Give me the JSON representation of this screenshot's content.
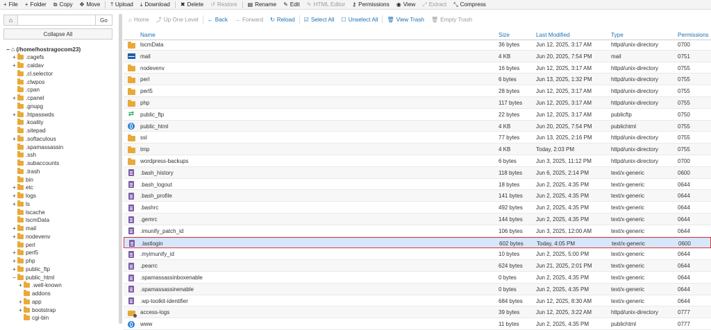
{
  "toolbar": [
    {
      "name": "file-button",
      "icon": "plus-icon",
      "glyph": "+",
      "label": "File",
      "disabled": false
    },
    {
      "name": "folder-button",
      "icon": "plus-icon",
      "glyph": "+",
      "label": "Folder",
      "disabled": false
    },
    {
      "name": "copy-button",
      "icon": "copy-icon",
      "glyph": "⧉",
      "label": "Copy",
      "disabled": false
    },
    {
      "name": "move-button",
      "icon": "move-icon",
      "glyph": "✥",
      "label": "Move",
      "disabled": false
    },
    {
      "name": "upload-button",
      "icon": "upload-icon",
      "glyph": "⤒",
      "label": "Upload",
      "disabled": false
    },
    {
      "name": "download-button",
      "icon": "download-icon",
      "glyph": "⤓",
      "label": "Download",
      "disabled": false
    },
    {
      "name": "delete-button",
      "icon": "close-icon",
      "glyph": "✖",
      "label": "Delete",
      "disabled": false
    },
    {
      "name": "restore-button",
      "icon": "restore-icon",
      "glyph": "↺",
      "label": "Restore",
      "disabled": true
    },
    {
      "name": "rename-button",
      "icon": "file-icon",
      "glyph": "▤",
      "label": "Rename",
      "disabled": false
    },
    {
      "name": "edit-button",
      "icon": "pencil-icon",
      "glyph": "✎",
      "label": "Edit",
      "disabled": false
    },
    {
      "name": "html-editor-button",
      "icon": "pencil-icon",
      "glyph": "✎",
      "label": "HTML Editor",
      "disabled": true
    },
    {
      "name": "permissions-button",
      "icon": "key-icon",
      "glyph": "⚷",
      "label": "Permissions",
      "disabled": false
    },
    {
      "name": "view-button",
      "icon": "eye-icon",
      "glyph": "◉",
      "label": "View",
      "disabled": false
    },
    {
      "name": "extract-button",
      "icon": "extract-icon",
      "glyph": "⤢",
      "label": "Extract",
      "disabled": true
    },
    {
      "name": "compress-button",
      "icon": "compress-icon",
      "glyph": "⤡",
      "label": "Compress",
      "disabled": false
    }
  ],
  "left": {
    "go_label": "Go",
    "collapse_label": "Collapse All",
    "path_value": ""
  },
  "tree": [
    {
      "label": "(/home/hostragocom23)",
      "level": 0,
      "toggle": "−",
      "root": true
    },
    {
      "label": ".cagefs",
      "level": 1,
      "toggle": "+"
    },
    {
      "label": ".caldav",
      "level": 1,
      "toggle": "+"
    },
    {
      "label": ".cl.selector",
      "level": 1,
      "toggle": ""
    },
    {
      "label": ".clwpos",
      "level": 1,
      "toggle": ""
    },
    {
      "label": ".cpan",
      "level": 1,
      "toggle": ""
    },
    {
      "label": ".cpanel",
      "level": 1,
      "toggle": "+"
    },
    {
      "label": ".gnupg",
      "level": 1,
      "toggle": ""
    },
    {
      "label": ".htpasswds",
      "level": 1,
      "toggle": "+"
    },
    {
      "label": ".koality",
      "level": 1,
      "toggle": ""
    },
    {
      "label": ".sitepad",
      "level": 1,
      "toggle": ""
    },
    {
      "label": ".softaculous",
      "level": 1,
      "toggle": "+"
    },
    {
      "label": ".spamassassin",
      "level": 1,
      "toggle": ""
    },
    {
      "label": ".ssh",
      "level": 1,
      "toggle": ""
    },
    {
      "label": ".subaccounts",
      "level": 1,
      "toggle": ""
    },
    {
      "label": ".trash",
      "level": 1,
      "toggle": ""
    },
    {
      "label": "bin",
      "level": 1,
      "toggle": ""
    },
    {
      "label": "etc",
      "level": 1,
      "toggle": "+"
    },
    {
      "label": "logs",
      "level": 1,
      "toggle": "+"
    },
    {
      "label": "ls",
      "level": 1,
      "toggle": "+"
    },
    {
      "label": "lscache",
      "level": 1,
      "toggle": ""
    },
    {
      "label": "lscmData",
      "level": 1,
      "toggle": ""
    },
    {
      "label": "mail",
      "level": 1,
      "toggle": "+"
    },
    {
      "label": "nodevenv",
      "level": 1,
      "toggle": "+"
    },
    {
      "label": "perl",
      "level": 1,
      "toggle": ""
    },
    {
      "label": "perl5",
      "level": 1,
      "toggle": "+"
    },
    {
      "label": "php",
      "level": 1,
      "toggle": "+"
    },
    {
      "label": "public_ftp",
      "level": 1,
      "toggle": "+"
    },
    {
      "label": "public_html",
      "level": 1,
      "toggle": "−"
    },
    {
      "label": ".well-known",
      "level": 2,
      "toggle": "+"
    },
    {
      "label": "addons",
      "level": 2,
      "toggle": ""
    },
    {
      "label": "app",
      "level": 2,
      "toggle": "+"
    },
    {
      "label": "bootstrap",
      "level": 2,
      "toggle": "+"
    },
    {
      "label": "cgi-bin",
      "level": 2,
      "toggle": ""
    }
  ],
  "navbar": [
    {
      "name": "home-nav-button",
      "icon": "home-icon",
      "glyph": "⌂",
      "label": "Home",
      "disabled": true
    },
    {
      "name": "up-one-level-button",
      "icon": "up-arrow-icon",
      "glyph": "⤴",
      "label": "Up One Level",
      "disabled": true
    },
    {
      "name": "back-button",
      "icon": "left-arrow-icon",
      "glyph": "←",
      "label": "Back",
      "disabled": false
    },
    {
      "name": "forward-button",
      "icon": "right-arrow-icon",
      "glyph": "→",
      "label": "Forward",
      "disabled": true
    },
    {
      "name": "reload-button",
      "icon": "reload-icon",
      "glyph": "↻",
      "label": "Reload",
      "disabled": false
    },
    {
      "name": "select-all-button",
      "icon": "checkbox-checked-icon",
      "glyph": "☑",
      "label": "Select All",
      "disabled": false
    },
    {
      "name": "unselect-all-button",
      "icon": "checkbox-empty-icon",
      "glyph": "☐",
      "label": "Unselect All",
      "disabled": false
    },
    {
      "name": "view-trash-button",
      "icon": "trash-icon",
      "glyph": "🗑",
      "label": "View Trash",
      "disabled": false
    },
    {
      "name": "empty-trash-button",
      "icon": "trash-icon",
      "glyph": "🗑",
      "label": "Empty Trash",
      "disabled": true
    }
  ],
  "table": {
    "headers": {
      "name": "Name",
      "size": "Size",
      "modified": "Last Modified",
      "type": "Type",
      "perms": "Permissions"
    },
    "rows": [
      {
        "icon": "folder",
        "name": "lscmData",
        "size": "36 bytes",
        "modified": "Jun 12, 2025, 3:17 AM",
        "type": "httpd/unix-directory",
        "perms": "0700"
      },
      {
        "icon": "mail",
        "name": "mail",
        "size": "4 KB",
        "modified": "Jun 20, 2025, 7:54 PM",
        "type": "mail",
        "perms": "0751"
      },
      {
        "icon": "folder",
        "name": "nodevenv",
        "size": "16 bytes",
        "modified": "Jun 12, 2025, 3:17 AM",
        "type": "httpd/unix-directory",
        "perms": "0755"
      },
      {
        "icon": "folder",
        "name": "perl",
        "size": "6 bytes",
        "modified": "Jun 13, 2025, 1:32 PM",
        "type": "httpd/unix-directory",
        "perms": "0755"
      },
      {
        "icon": "folder",
        "name": "perl5",
        "size": "28 bytes",
        "modified": "Jun 12, 2025, 3:17 AM",
        "type": "httpd/unix-directory",
        "perms": "0755"
      },
      {
        "icon": "folder",
        "name": "php",
        "size": "117 bytes",
        "modified": "Jun 12, 2025, 3:17 AM",
        "type": "httpd/unix-directory",
        "perms": "0755"
      },
      {
        "icon": "arrows",
        "name": "public_ftp",
        "size": "22 bytes",
        "modified": "Jun 12, 2025, 3:17 AM",
        "type": "publicftp",
        "perms": "0750"
      },
      {
        "icon": "globe",
        "name": "public_html",
        "size": "4 KB",
        "modified": "Jun 20, 2025, 7:54 PM",
        "type": "publichtml",
        "perms": "0755"
      },
      {
        "icon": "folder",
        "name": "ssl",
        "size": "77 bytes",
        "modified": "Jun 13, 2025, 2:16 PM",
        "type": "httpd/unix-directory",
        "perms": "0755"
      },
      {
        "icon": "folder",
        "name": "tmp",
        "size": "4 KB",
        "modified": "Today, 2:03 PM",
        "type": "httpd/unix-directory",
        "perms": "0755"
      },
      {
        "icon": "folder",
        "name": "wordpress-backups",
        "size": "6 bytes",
        "modified": "Jun 3, 2025, 11:12 PM",
        "type": "httpd/unix-directory",
        "perms": "0700"
      },
      {
        "icon": "file",
        "name": ".bash_history",
        "size": "118 bytes",
        "modified": "Jun 6, 2025, 2:14 PM",
        "type": "text/x-generic",
        "perms": "0600"
      },
      {
        "icon": "file",
        "name": ".bash_logout",
        "size": "18 bytes",
        "modified": "Jun 2, 2025, 4:35 PM",
        "type": "text/x-generic",
        "perms": "0644"
      },
      {
        "icon": "file",
        "name": ".bash_profile",
        "size": "141 bytes",
        "modified": "Jun 2, 2025, 4:35 PM",
        "type": "text/x-generic",
        "perms": "0644"
      },
      {
        "icon": "file",
        "name": ".bashrc",
        "size": "492 bytes",
        "modified": "Jun 2, 2025, 4:35 PM",
        "type": "text/x-generic",
        "perms": "0644"
      },
      {
        "icon": "file",
        "name": ".gemrc",
        "size": "144 bytes",
        "modified": "Jun 2, 2025, 4:35 PM",
        "type": "text/x-generic",
        "perms": "0644"
      },
      {
        "icon": "file",
        "name": ".imunify_patch_id",
        "size": "106 bytes",
        "modified": "Jun 3, 2025, 12:00 AM",
        "type": "text/x-generic",
        "perms": "0644"
      },
      {
        "icon": "file",
        "name": ".lastlogin",
        "size": "602 bytes",
        "modified": "Today, 4:05 PM",
        "type": "text/x-generic",
        "perms": "0600",
        "selected": true
      },
      {
        "icon": "file",
        "name": ".myimunify_id",
        "size": "10 bytes",
        "modified": "Jun 2, 2025, 5:00 PM",
        "type": "text/x-generic",
        "perms": "0644"
      },
      {
        "icon": "file",
        "name": ".pearrc",
        "size": "624 bytes",
        "modified": "Jun 21, 2025, 2:01 PM",
        "type": "text/x-generic",
        "perms": "0644"
      },
      {
        "icon": "file",
        "name": ".spamassassinboxenable",
        "size": "0 bytes",
        "modified": "Jun 2, 2025, 4:35 PM",
        "type": "text/x-generic",
        "perms": "0644"
      },
      {
        "icon": "file",
        "name": ".spamassassinenable",
        "size": "0 bytes",
        "modified": "Jun 2, 2025, 4:35 PM",
        "type": "text/x-generic",
        "perms": "0644"
      },
      {
        "icon": "file",
        "name": ".wp-toolkit-identifier",
        "size": "684 bytes",
        "modified": "Jun 12, 2025, 8:30 AM",
        "type": "text/x-generic",
        "perms": "0644"
      },
      {
        "icon": "foldgear",
        "name": "access-logs",
        "size": "39 bytes",
        "modified": "Jun 12, 2025, 3:22 AM",
        "type": "httpd/unix-directory",
        "perms": "0777"
      },
      {
        "icon": "globe",
        "name": "www",
        "size": "11 bytes",
        "modified": "Jun 2, 2025, 4:35 PM",
        "type": "publichtml",
        "perms": "0777"
      }
    ]
  },
  "colors": {
    "link": "#1a6fb3",
    "folder": "#e8a93b",
    "file": "#7b5ea7",
    "selected_border": "#e0353b",
    "selected_bg": "#d6e7fb"
  }
}
